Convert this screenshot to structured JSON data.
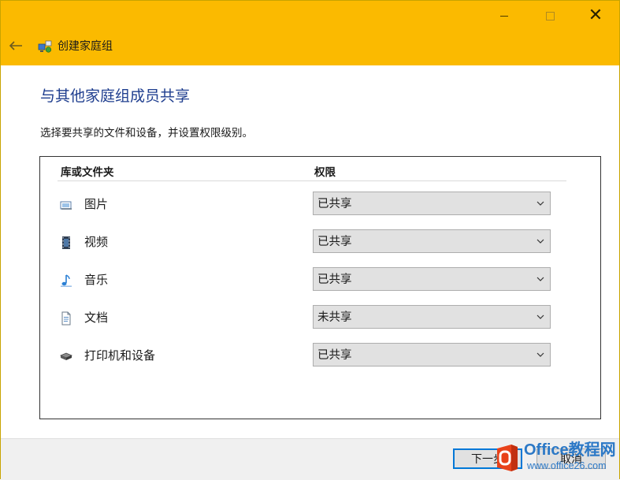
{
  "window": {
    "title": "创建家庭组",
    "accent_color": "#fbba00",
    "controls": {
      "minimize_icon": "minimize-icon",
      "maximize_icon": "maximize-icon",
      "close_icon": "close-icon"
    }
  },
  "page": {
    "heading": "与其他家庭组成员共享",
    "description": "选择要共享的文件和设备，并设置权限级别。"
  },
  "table": {
    "columns": [
      "库或文件夹",
      "权限"
    ],
    "rows": [
      {
        "icon": "pictures-icon",
        "label": "图片",
        "permission": "已共享"
      },
      {
        "icon": "videos-icon",
        "label": "视频",
        "permission": "已共享"
      },
      {
        "icon": "music-icon",
        "label": "音乐",
        "permission": "已共享"
      },
      {
        "icon": "documents-icon",
        "label": "文档",
        "permission": "未共享"
      },
      {
        "icon": "printer-icon",
        "label": "打印机和设备",
        "permission": "已共享"
      }
    ]
  },
  "footer": {
    "next_label": "下一步",
    "cancel_label": "取消"
  },
  "watermark": {
    "line1": "Office教程网",
    "line2": "www.office26.com"
  }
}
